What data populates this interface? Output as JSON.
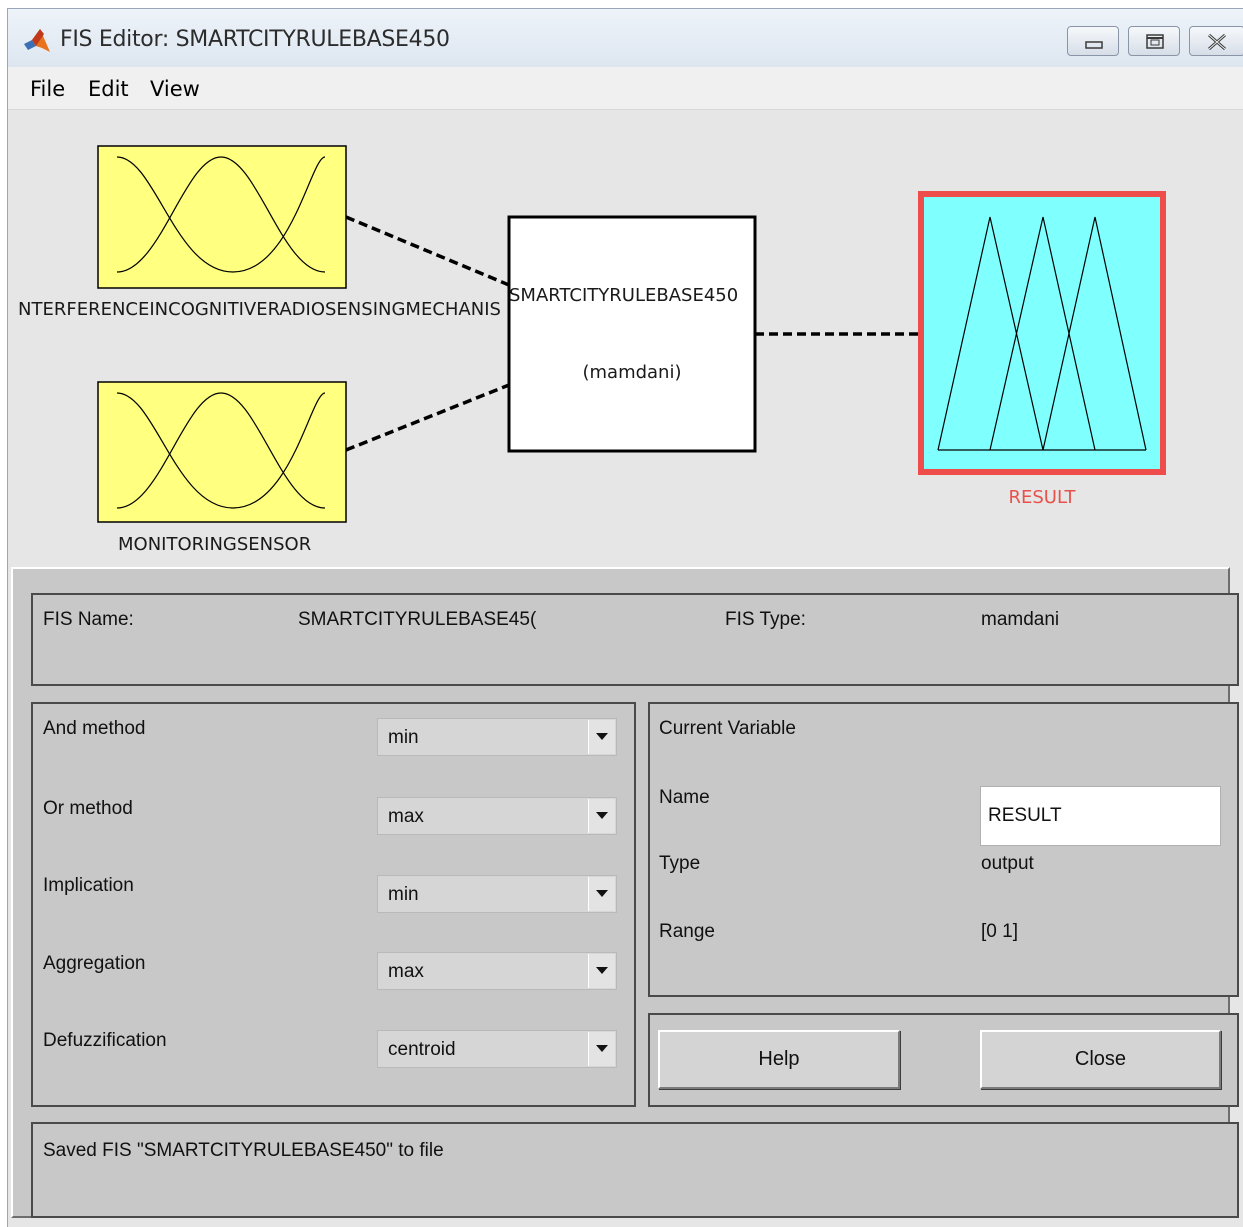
{
  "window": {
    "title": "FIS Editor: SMARTCITYRULEBASE450",
    "icon": "matlab-logo-icon",
    "controls": [
      "minimize-icon",
      "maximize-icon",
      "close-icon"
    ]
  },
  "menu": {
    "file": "File",
    "edit": "Edit",
    "view": "View"
  },
  "diagram": {
    "inputs": [
      "NTERFERENCEINCOGNITIVERADIOSENSINGMECHANIS",
      "MONITORINGSENSOR"
    ],
    "system_name": "SMARTCITYRULEBASE450",
    "system_type": "(mamdani)",
    "output": "RESULT",
    "colors": {
      "input_fill": "#ffff80",
      "output_fill": "#80ffff",
      "output_selected_border": "#ef4c4c",
      "output_label": "#e8504a"
    }
  },
  "fis": {
    "name_label": "FIS Name:",
    "name_value": "SMARTCITYRULEBASE45(",
    "type_label": "FIS Type:",
    "type_value": "mamdani"
  },
  "methods": [
    {
      "label": "And method",
      "value": "min"
    },
    {
      "label": "Or method",
      "value": "max"
    },
    {
      "label": "Implication",
      "value": "min"
    },
    {
      "label": "Aggregation",
      "value": "max"
    },
    {
      "label": "Defuzzification",
      "value": "centroid"
    }
  ],
  "current_variable": {
    "heading": "Current Variable",
    "name_label": "Name",
    "name_value": "RESULT",
    "type_label": "Type",
    "type_value": "output",
    "range_label": "Range",
    "range_value": "[0 1]"
  },
  "buttons": {
    "help": "Help",
    "close": "Close"
  },
  "status": "Saved FIS \"SMARTCITYRULEBASE450\" to file"
}
